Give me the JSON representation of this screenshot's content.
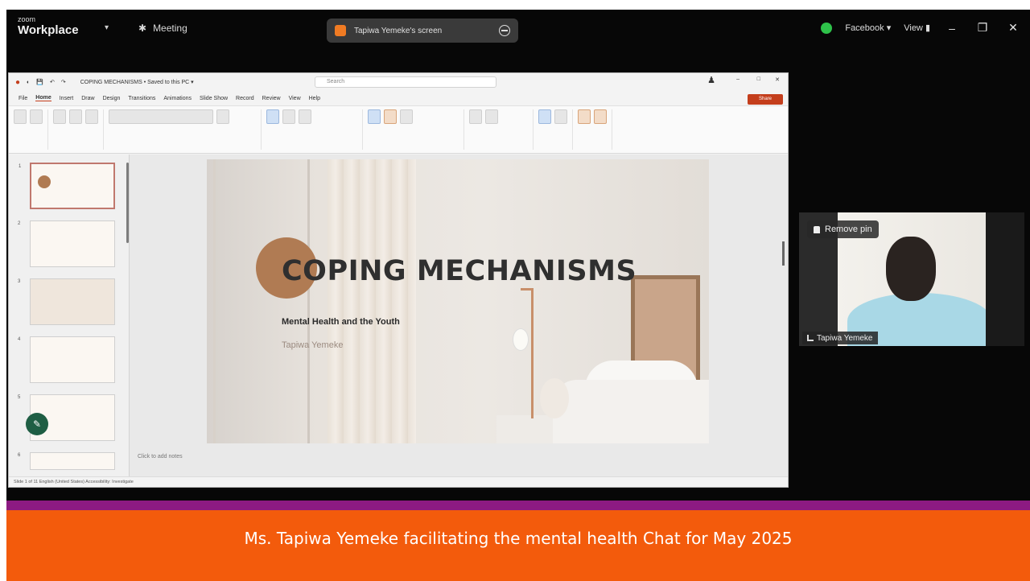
{
  "zoom": {
    "brand_small": "zoom",
    "brand_big": "Workplace",
    "meeting_label": "Meeting",
    "share_label": "Tapiwa Yemeke's screen",
    "facebook_label": "Facebook ▾",
    "view_label": "View"
  },
  "ppt": {
    "title": "COPING MECHANISMS • Saved to this PC ▾",
    "search_placeholder": "Search",
    "tabs": [
      "File",
      "Home",
      "Insert",
      "Draw",
      "Design",
      "Transitions",
      "Animations",
      "Slide Show",
      "Record",
      "Review",
      "View",
      "Help"
    ],
    "share_label": "Share",
    "notes_placeholder": "Click to add notes",
    "status_text": "Slide 1 of 11   English (United States)     Accessibility: Investigate"
  },
  "slide": {
    "title": "COPING MECHANISMS",
    "subtitle": "Mental Health and the Youth",
    "author": "Tapiwa Yemeke"
  },
  "participant": {
    "pin_label": "Remove pin",
    "name": "Tapiwa Yemeke"
  },
  "caption": {
    "text": "Ms. Tapiwa Yemeke facilitating the mental health Chat for May 2025"
  }
}
